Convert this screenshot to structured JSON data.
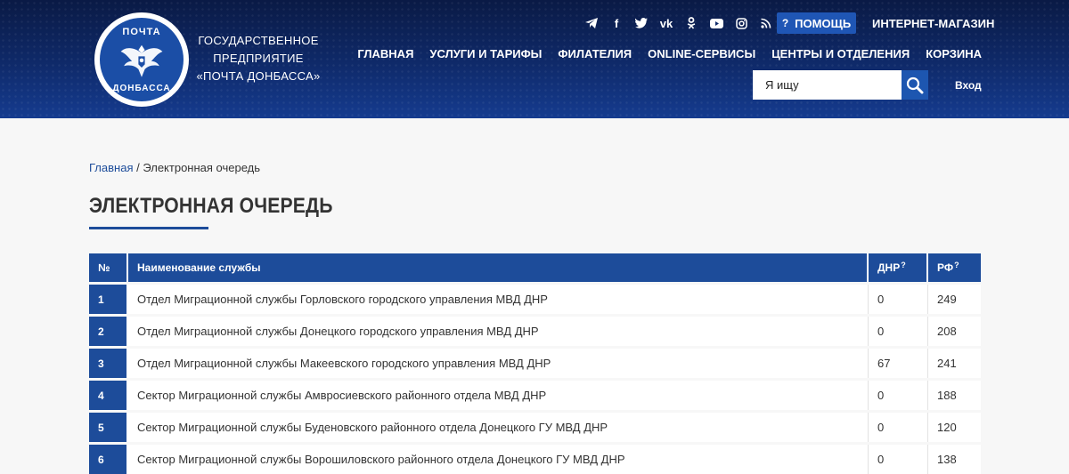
{
  "header": {
    "logo": {
      "top_text": "ПОЧТА",
      "bottom_text": "ДОНБАССА"
    },
    "org_name_lines": [
      "ГОСУДАРСТВЕННОЕ",
      "ПРЕДПРИЯТИЕ",
      "«ПОЧТА ДОНБАССА»"
    ],
    "socials": [
      {
        "name": "telegram-icon",
        "glyph": "➤"
      },
      {
        "name": "facebook-icon",
        "glyph": "f"
      },
      {
        "name": "twitter-icon",
        "glyph": "🐦"
      },
      {
        "name": "vk-icon",
        "glyph": "vk"
      },
      {
        "name": "odnoklassniki-icon",
        "glyph": "ок"
      },
      {
        "name": "youtube-icon",
        "glyph": "▶"
      },
      {
        "name": "instagram-icon",
        "glyph": "◎"
      },
      {
        "name": "rss-icon",
        "glyph": "◟"
      }
    ],
    "help_label": "ПОМОЩЬ",
    "help_icon": "?",
    "shop_label": "ИНТЕРНЕТ-МАГАЗИН",
    "nav": [
      "ГЛАВНАЯ",
      "УСЛУГИ И ТАРИФЫ",
      "ФИЛАТЕЛИЯ",
      "ONLINE-СЕРВИСЫ",
      "ЦЕНТРЫ И ОТДЕЛЕНИЯ",
      "КОРЗИНА"
    ],
    "search_placeholder": "Я ищу",
    "login_label": "Вход"
  },
  "breadcrumb": {
    "home": "Главная",
    "separator": " / ",
    "current": "Электронная очередь"
  },
  "page_title": "ЭЛЕКТРОННАЯ ОЧЕРЕДЬ",
  "table": {
    "headers": {
      "num": "№",
      "name": "Наименование службы",
      "dnr": "ДНР",
      "rf": "РФ",
      "hint": "?"
    },
    "rows": [
      {
        "num": "1",
        "name": "Отдел Миграционной службы Горловского городского управления МВД ДНР",
        "dnr": "0",
        "rf": "249"
      },
      {
        "num": "2",
        "name": "Отдел Миграционной службы Донецкого городского управления МВД ДНР",
        "dnr": "0",
        "rf": "208"
      },
      {
        "num": "3",
        "name": "Отдел Миграционной службы Макеевского городского управления МВД ДНР",
        "dnr": "67",
        "rf": "241"
      },
      {
        "num": "4",
        "name": "Сектор Миграционной службы Амвросиевского районного отдела МВД ДНР",
        "dnr": "0",
        "rf": "188"
      },
      {
        "num": "5",
        "name": "Сектор Миграционной службы Буденовского районного отдела Донецкого ГУ МВД ДНР",
        "dnr": "0",
        "rf": "120"
      },
      {
        "num": "6",
        "name": "Сектор Миграционной службы Ворошиловского районного отдела Донецкого ГУ МВД ДНР",
        "dnr": "0",
        "rf": "138"
      }
    ]
  }
}
